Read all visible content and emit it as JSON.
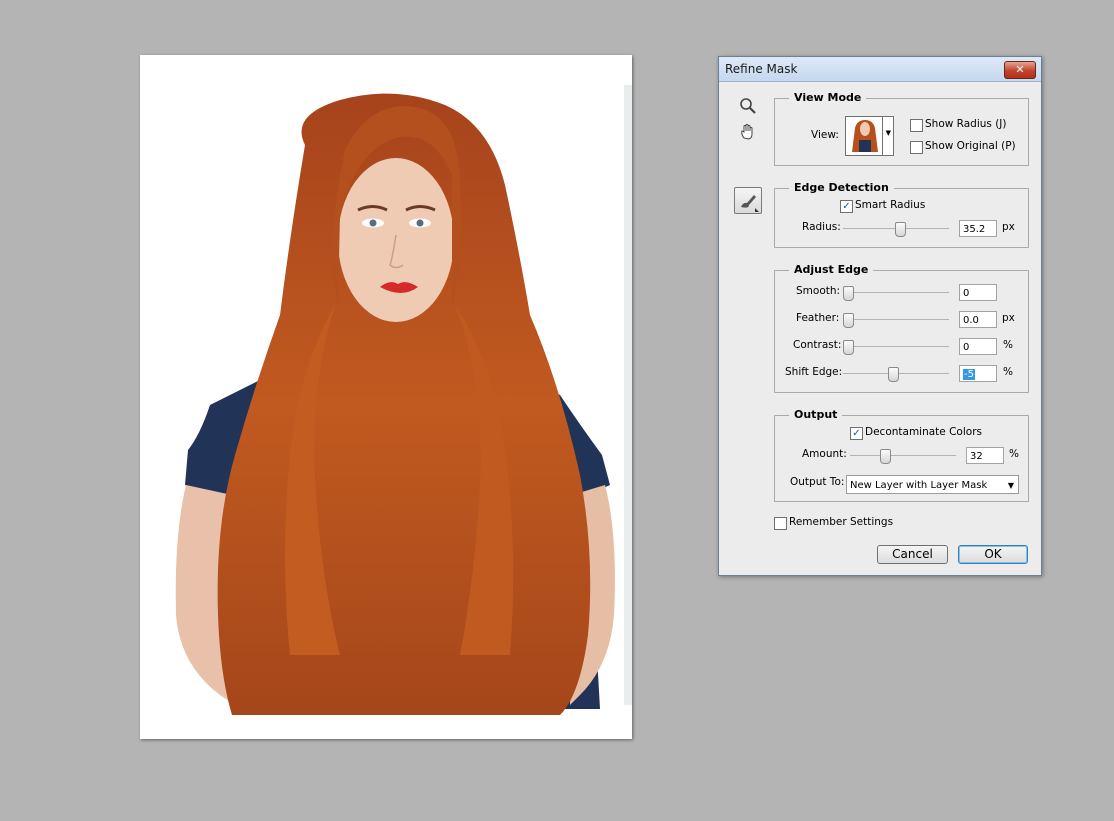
{
  "dialog": {
    "title": "Refine Mask",
    "close_glyph": "✕",
    "tools": [
      "zoom-icon",
      "hand-icon",
      "refine-radius-brush-icon"
    ],
    "view_mode": {
      "legend": "View Mode",
      "view_label": "View:",
      "show_radius": {
        "label": "Show Radius (J)",
        "checked": false
      },
      "show_original": {
        "label": "Show Original (P)",
        "checked": false
      }
    },
    "edge_detection": {
      "legend": "Edge Detection",
      "smart_radius": {
        "label": "Smart Radius",
        "checked": true
      },
      "radius": {
        "label": "Radius:",
        "value": "35.2",
        "unit": "px",
        "level": 0.55
      }
    },
    "adjust_edge": {
      "legend": "Adjust Edge",
      "smooth": {
        "label": "Smooth:",
        "value": "0",
        "unit": "",
        "level": 0.0
      },
      "feather": {
        "label": "Feather:",
        "value": "0.0",
        "unit": "px",
        "level": 0.0
      },
      "contrast": {
        "label": "Contrast:",
        "value": "0",
        "unit": "%",
        "level": 0.0
      },
      "shift_edge": {
        "label": "Shift Edge:",
        "value": "-5",
        "unit": "%",
        "level": 0.475
      }
    },
    "output": {
      "legend": "Output",
      "decontaminate": {
        "label": "Decontaminate Colors",
        "checked": true
      },
      "amount": {
        "label": "Amount:",
        "value": "32",
        "unit": "%",
        "level": 0.32
      },
      "output_to_label": "Output To:",
      "output_to_value": "New Layer with Layer Mask"
    },
    "remember": {
      "label": "Remember Settings",
      "checked": false
    },
    "cancel_label": "Cancel",
    "ok_label": "OK"
  },
  "colors": {
    "workspace": "#b4b4b4",
    "hair": "#b8501c",
    "shirt": "#213357",
    "skin": "#efc7ae",
    "lips": "#d62a2a"
  }
}
